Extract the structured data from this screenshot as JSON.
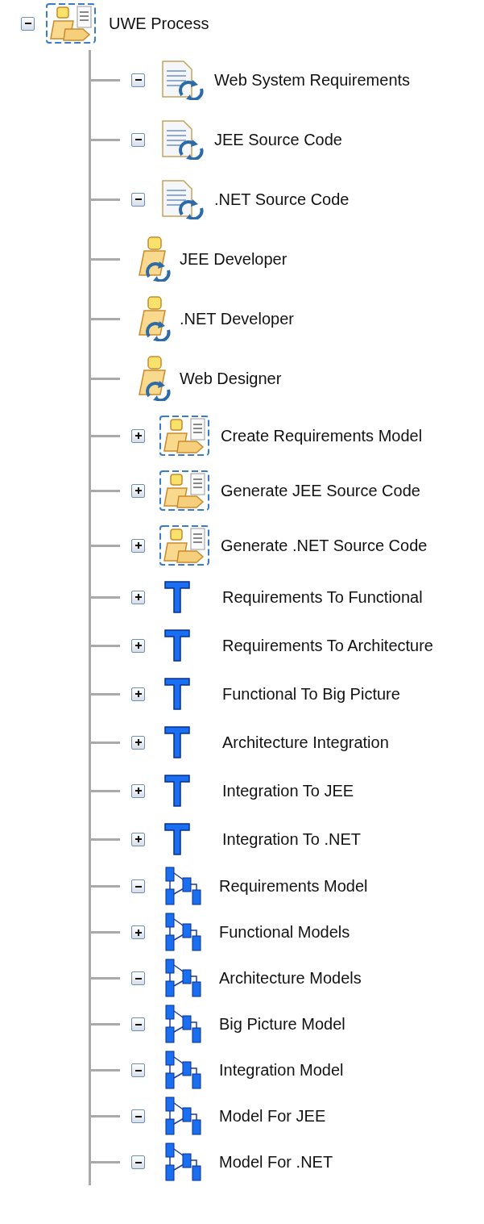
{
  "tree": {
    "label": "UWE Process",
    "kind": "process",
    "expanded": true,
    "children": [
      {
        "label": "Web System Requirements",
        "kind": "artifact",
        "expanded": true
      },
      {
        "label": "JEE Source Code",
        "kind": "artifact",
        "expanded": true
      },
      {
        "label": ".NET Source Code",
        "kind": "artifact",
        "expanded": true
      },
      {
        "label": "JEE Developer",
        "kind": "role"
      },
      {
        "label": ".NET Developer",
        "kind": "role"
      },
      {
        "label": "Web Designer",
        "kind": "role"
      },
      {
        "label": "Create Requirements Model",
        "kind": "process",
        "expanded": false
      },
      {
        "label": "Generate JEE Source Code",
        "kind": "process",
        "expanded": false
      },
      {
        "label": "Generate .NET Source Code",
        "kind": "process",
        "expanded": false
      },
      {
        "label": "Requirements To Functional",
        "kind": "transformation",
        "expanded": false
      },
      {
        "label": "Requirements To Architecture",
        "kind": "transformation",
        "expanded": false
      },
      {
        "label": "Functional To Big Picture",
        "kind": "transformation",
        "expanded": false
      },
      {
        "label": "Architecture Integration",
        "kind": "transformation",
        "expanded": false
      },
      {
        "label": "Integration To JEE",
        "kind": "transformation",
        "expanded": false
      },
      {
        "label": "Integration To .NET",
        "kind": "transformation",
        "expanded": false
      },
      {
        "label": "Requirements Model",
        "kind": "model",
        "expanded": true
      },
      {
        "label": "Functional Models",
        "kind": "model",
        "expanded": false
      },
      {
        "label": "Architecture Models",
        "kind": "model",
        "expanded": true
      },
      {
        "label": "Big Picture Model",
        "kind": "model",
        "expanded": true
      },
      {
        "label": "Integration Model",
        "kind": "model",
        "expanded": true
      },
      {
        "label": "Model For JEE",
        "kind": "model",
        "expanded": true
      },
      {
        "label": "Model For .NET",
        "kind": "model",
        "expanded": true
      }
    ]
  }
}
